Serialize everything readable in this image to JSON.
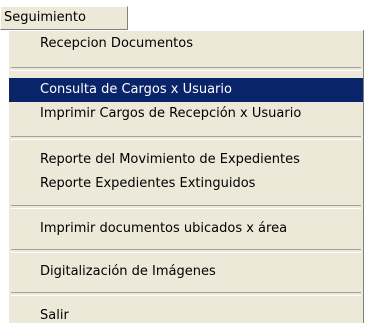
{
  "menu": {
    "title": "Seguimiento",
    "items": [
      {
        "label": "Recepcion Documentos"
      },
      {
        "label": "Consulta de Cargos x Usuario",
        "highlighted": true
      },
      {
        "label": "Imprimir Cargos de Recepción x Usuario"
      },
      {
        "label": "Reporte del Movimiento de Expedientes"
      },
      {
        "label": "Reporte Expedientes Extinguidos"
      },
      {
        "label": "Imprimir documentos ubicados x área"
      },
      {
        "label": "Digitalización de Imágenes"
      },
      {
        "label": "Salir"
      }
    ]
  },
  "colors": {
    "menu_background": "#ece9d8",
    "highlight_background": "#0a246a",
    "highlight_text": "#ffffff"
  }
}
